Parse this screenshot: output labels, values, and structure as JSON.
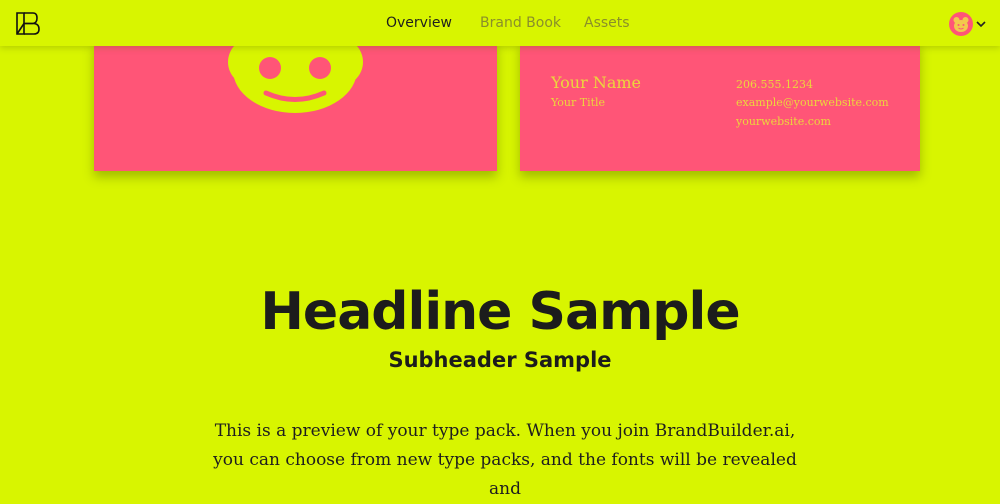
{
  "header": {
    "nav": [
      {
        "label": "Overview",
        "active": true
      },
      {
        "label": "Brand Book",
        "active": false
      },
      {
        "label": "Assets",
        "active": false
      }
    ]
  },
  "business_card": {
    "name": "Your Name",
    "title": "Your Title",
    "phone": "206.555.1234",
    "email": "example@yourwebsite.com",
    "website": "yourwebsite.com"
  },
  "preview": {
    "headline": "Headline Sample",
    "subheader": "Subheader Sample",
    "body": "This is a preview of your type pack. When you join BrandBuilder.ai, you can choose from new type packs, and the fonts will be revealed and"
  },
  "colors": {
    "background": "#d8f500",
    "card": "#ff5577",
    "card_text": "#ecd63c",
    "text": "#1c1c1c"
  }
}
